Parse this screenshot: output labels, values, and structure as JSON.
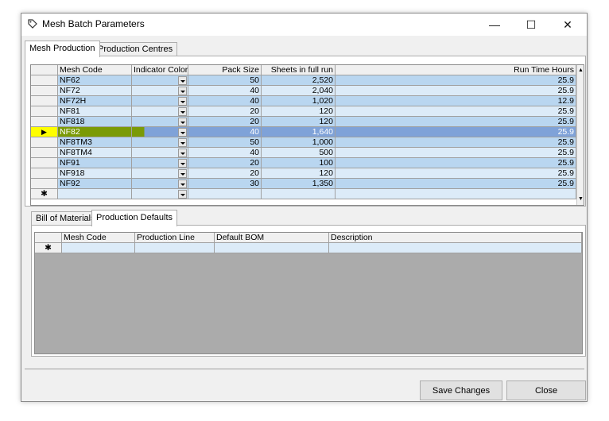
{
  "window": {
    "title": "Mesh Batch Parameters"
  },
  "titlebar": {
    "minimize": "—",
    "maximize": "☐",
    "close": "✕"
  },
  "tabs_top": [
    {
      "label": "Mesh Production",
      "active": true
    },
    {
      "label": "Production Centres",
      "active": false
    }
  ],
  "top_grid": {
    "columns": [
      "Mesh Code",
      "Indicator Color",
      "Pack Size",
      "Sheets in full run",
      "Run Time Hours"
    ],
    "rows": [
      {
        "code": "NF62",
        "pack": "50",
        "sheets": "2,520",
        "hours": "25.9"
      },
      {
        "code": "NF72",
        "pack": "40",
        "sheets": "2,040",
        "hours": "25.9"
      },
      {
        "code": "NF72H",
        "pack": "40",
        "sheets": "1,020",
        "hours": "12.9"
      },
      {
        "code": "NF81",
        "pack": "20",
        "sheets": "120",
        "hours": "25.9"
      },
      {
        "code": "NF818",
        "pack": "20",
        "sheets": "120",
        "hours": "25.9"
      },
      {
        "code": "NF82",
        "pack": "40",
        "sheets": "1,640",
        "hours": "25.9",
        "selected": true,
        "indicator": "#7a9a06"
      },
      {
        "code": "NF8TM3",
        "pack": "50",
        "sheets": "1,000",
        "hours": "25.9"
      },
      {
        "code": "NF8TM4",
        "pack": "40",
        "sheets": "500",
        "hours": "25.9"
      },
      {
        "code": "NF91",
        "pack": "20",
        "sheets": "100",
        "hours": "25.9"
      },
      {
        "code": "NF918",
        "pack": "20",
        "sheets": "120",
        "hours": "25.9"
      },
      {
        "code": "NF92",
        "pack": "30",
        "sheets": "1,350",
        "hours": "25.9"
      }
    ],
    "new_row_marker": "✱",
    "current_row_marker": "▶"
  },
  "tabs_bottom": [
    {
      "label": "Bill of Materials",
      "active": false
    },
    {
      "label": "Production Defaults",
      "active": true
    }
  ],
  "bottom_grid": {
    "columns": [
      "Mesh Code",
      "Production Line",
      "Default BOM",
      "Description"
    ],
    "new_row_marker": "✱"
  },
  "buttons": {
    "save": "Save Changes",
    "close": "Close"
  },
  "colors": {
    "row_dark": "#b9d6f0",
    "row_light": "#dcebf8",
    "selected": "#7fa2d8",
    "selected_marker_bg": "#ffff00"
  }
}
